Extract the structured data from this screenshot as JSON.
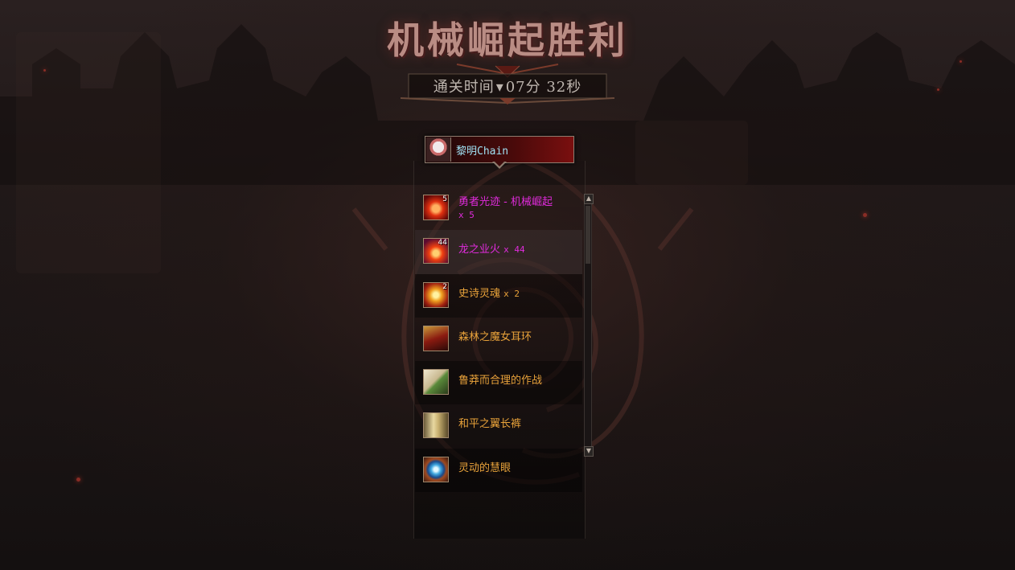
{
  "title": "机械崛起胜利",
  "clear_time": {
    "label": "通关时间",
    "value": "07分 32秒"
  },
  "player": {
    "name": "黎明Chain"
  },
  "rewards": [
    {
      "name": "勇者光迹 - 机械崛起",
      "count": "x 5",
      "qty": "5",
      "rarity": "epic",
      "icon": "hero-light-icon"
    },
    {
      "name": "龙之业火",
      "count": "x 44",
      "qty": "44",
      "rarity": "epic",
      "icon": "dragon-flame-icon"
    },
    {
      "name": "史诗灵魂",
      "count": "x 2",
      "qty": "2",
      "rarity": "legend",
      "icon": "epic-soul-icon"
    },
    {
      "name": "森林之魔女耳环",
      "count": "",
      "qty": "",
      "rarity": "legend",
      "icon": "witch-earring-icon"
    },
    {
      "name": "鲁莽而合理的作战",
      "count": "",
      "qty": "",
      "rarity": "legend",
      "icon": "tactics-card-icon"
    },
    {
      "name": "和平之翼长裤",
      "count": "",
      "qty": "",
      "rarity": "legend",
      "icon": "peace-wing-pants-icon"
    },
    {
      "name": "灵动的慧眼",
      "count": "",
      "qty": "",
      "rarity": "legend",
      "icon": "wise-eye-icon"
    }
  ],
  "colors": {
    "epic": "#e02bdc",
    "legend": "#e8a23a",
    "player_name": "#9fe0f2"
  }
}
